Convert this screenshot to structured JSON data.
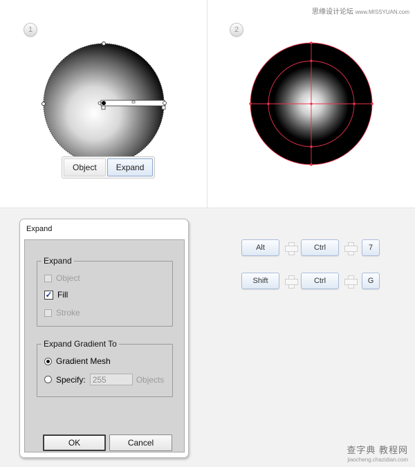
{
  "watermark_top": {
    "text": "思缘设计论坛",
    "url": "www.MISSYUAN.com"
  },
  "steps": {
    "one": "1",
    "two": "2"
  },
  "object_toolbar": {
    "object_label": "Object",
    "expand_label": "Expand"
  },
  "colors": {
    "guide_red": "#e8344a",
    "key_border": "#a9bdd8",
    "dialog_bg": "#d4d4d4"
  },
  "expand_dialog": {
    "title": "Expand",
    "expand_group": {
      "legend": "Expand",
      "object_label": "Object",
      "fill_label": "Fill",
      "stroke_label": "Stroke",
      "object_checked": false,
      "fill_checked": true,
      "stroke_checked": false
    },
    "gradient_group": {
      "legend": "Expand Gradient To",
      "mesh_label": "Gradient Mesh",
      "specify_label": "Specify:",
      "specify_value": "255",
      "objects_label": "Objects",
      "selected": "Gradient Mesh"
    },
    "ok_label": "OK",
    "cancel_label": "Cancel"
  },
  "shortcuts": [
    {
      "keys": [
        "Alt",
        "Ctrl",
        "7"
      ]
    },
    {
      "keys": [
        "Shift",
        "Ctrl",
        "G"
      ]
    }
  ],
  "watermark_bottom": {
    "title": "查字典 教程网",
    "url": "jiaocheng.chazidian.com"
  }
}
